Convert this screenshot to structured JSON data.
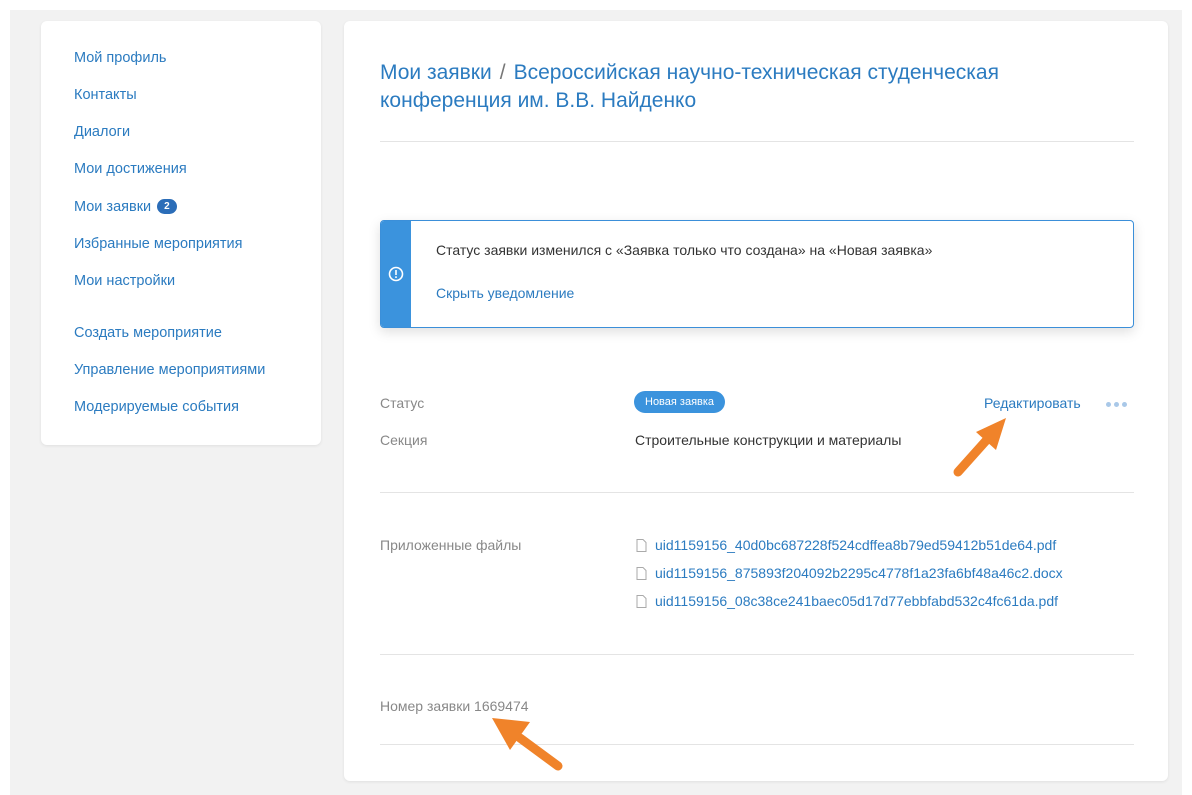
{
  "sidebar": {
    "items": [
      {
        "label": "Мой профиль"
      },
      {
        "label": "Контакты"
      },
      {
        "label": "Диалоги"
      },
      {
        "label": "Мои достижения"
      },
      {
        "label": "Мои заявки",
        "badge": "2"
      },
      {
        "label": "Избранные мероприятия"
      },
      {
        "label": "Мои настройки"
      },
      {
        "label": "Создать мероприятие"
      },
      {
        "label": "Управление мероприятиями"
      },
      {
        "label": "Модерируемые события"
      }
    ]
  },
  "main": {
    "breadcrumb_parent": "Мои заявки",
    "breadcrumb_sep": "/",
    "title": "Всероссийская научно-техническая студенческая конференция им. В.В. Найденко",
    "notice": {
      "message": "Статус заявки изменился с «Заявка только что создана» на «Новая заявка»",
      "hide_link": "Скрыть уведомление",
      "icon": "info-circle-icon"
    },
    "status_label": "Статус",
    "status_value": "Новая заявка",
    "edit_label": "Редактировать",
    "section_label": "Секция",
    "section_value": "Строительные конструкции и материалы",
    "files_label": "Приложенные файлы",
    "files": [
      "uid1159156_40d0bc687228f524cdffea8b79ed59412b51de64.pdf",
      "uid1159156_875893f204092b2295c4778f1a23fa6bf48a46c2.docx",
      "uid1159156_08c38ce241baec05d17d77ebbfabd532c4fc61da.pdf"
    ],
    "number_text": "Номер заявки 1669474"
  },
  "colors": {
    "accent": "#2b7bc0",
    "notice_stripe": "#3b93dd",
    "annotation_arrow": "#f0832a"
  }
}
